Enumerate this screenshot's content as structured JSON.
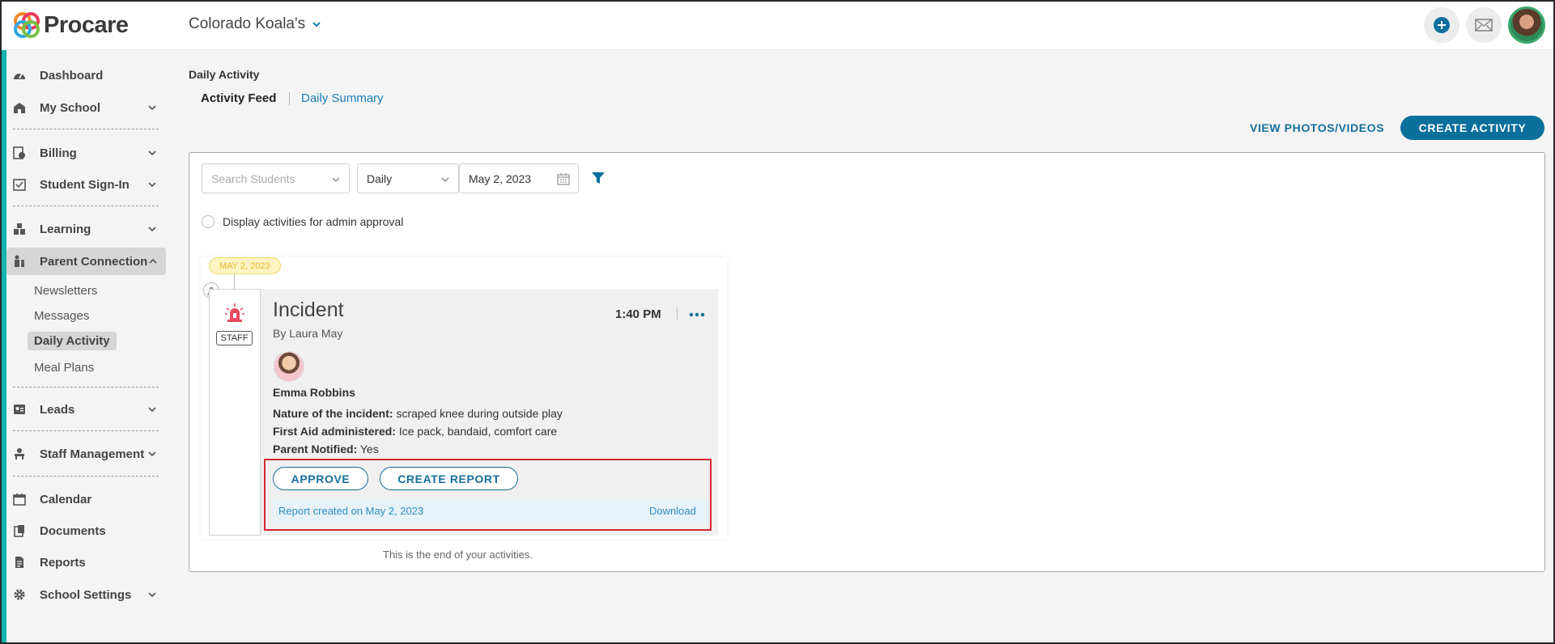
{
  "brand": {
    "name": "Procare"
  },
  "header": {
    "school_name": "Colorado Koala's",
    "add_icon": "plus-circle-icon",
    "mail_icon": "envelope-icon"
  },
  "sidebar": {
    "items": [
      {
        "label": "Dashboard",
        "icon": "dashboard-icon"
      },
      {
        "label": "My School",
        "icon": "school-icon"
      },
      {
        "label": "Billing",
        "icon": "billing-icon"
      },
      {
        "label": "Student Sign-In",
        "icon": "sign-in-icon"
      },
      {
        "label": "Learning",
        "icon": "learning-icon"
      },
      {
        "label": "Parent Connection",
        "icon": "parent-icon"
      },
      {
        "label": "Leads",
        "icon": "leads-icon"
      },
      {
        "label": "Staff Management",
        "icon": "staff-icon"
      },
      {
        "label": "Calendar",
        "icon": "calendar-icon"
      },
      {
        "label": "Documents",
        "icon": "documents-icon"
      },
      {
        "label": "Reports",
        "icon": "reports-icon"
      },
      {
        "label": "School Settings",
        "icon": "gear-icon"
      }
    ],
    "sub_items": [
      "Newsletters",
      "Messages",
      "Daily Activity",
      "Meal Plans"
    ]
  },
  "main": {
    "page_title": "Daily Activity",
    "tabs": [
      "Activity Feed",
      "Daily Summary"
    ],
    "view_photos": "VIEW PHOTOS/VIDEOS",
    "create_activity": "CREATE ACTIVITY",
    "filters": {
      "search_placeholder": "Search Students",
      "period": "Daily",
      "date": "May 2, 2023"
    },
    "admin_approval_label": "Display activities for admin approval"
  },
  "activity": {
    "date_badge": "MAY 2, 2023",
    "staff_badge": "STAFF",
    "title": "Incident",
    "by": "By Laura May",
    "time": "1:40 PM",
    "student": "Emma Robbins",
    "details": [
      {
        "label": "Nature of the incident:",
        "value": "scraped knee during outside play"
      },
      {
        "label": "First Aid administered:",
        "value": "Ice pack, bandaid, comfort care"
      },
      {
        "label": "Parent Notified:",
        "value": "Yes"
      }
    ],
    "approve": "APPROVE",
    "create_report": "CREATE REPORT",
    "report_created": "Report created on May 2, 2023",
    "download": "Download"
  },
  "footer_text": "This is the end of your activities.",
  "colors": {
    "accent": "#0b6f9c",
    "sidebar_bar": "#16b3b3",
    "highlight": "#d6262f",
    "badge": "#fff4c2"
  }
}
